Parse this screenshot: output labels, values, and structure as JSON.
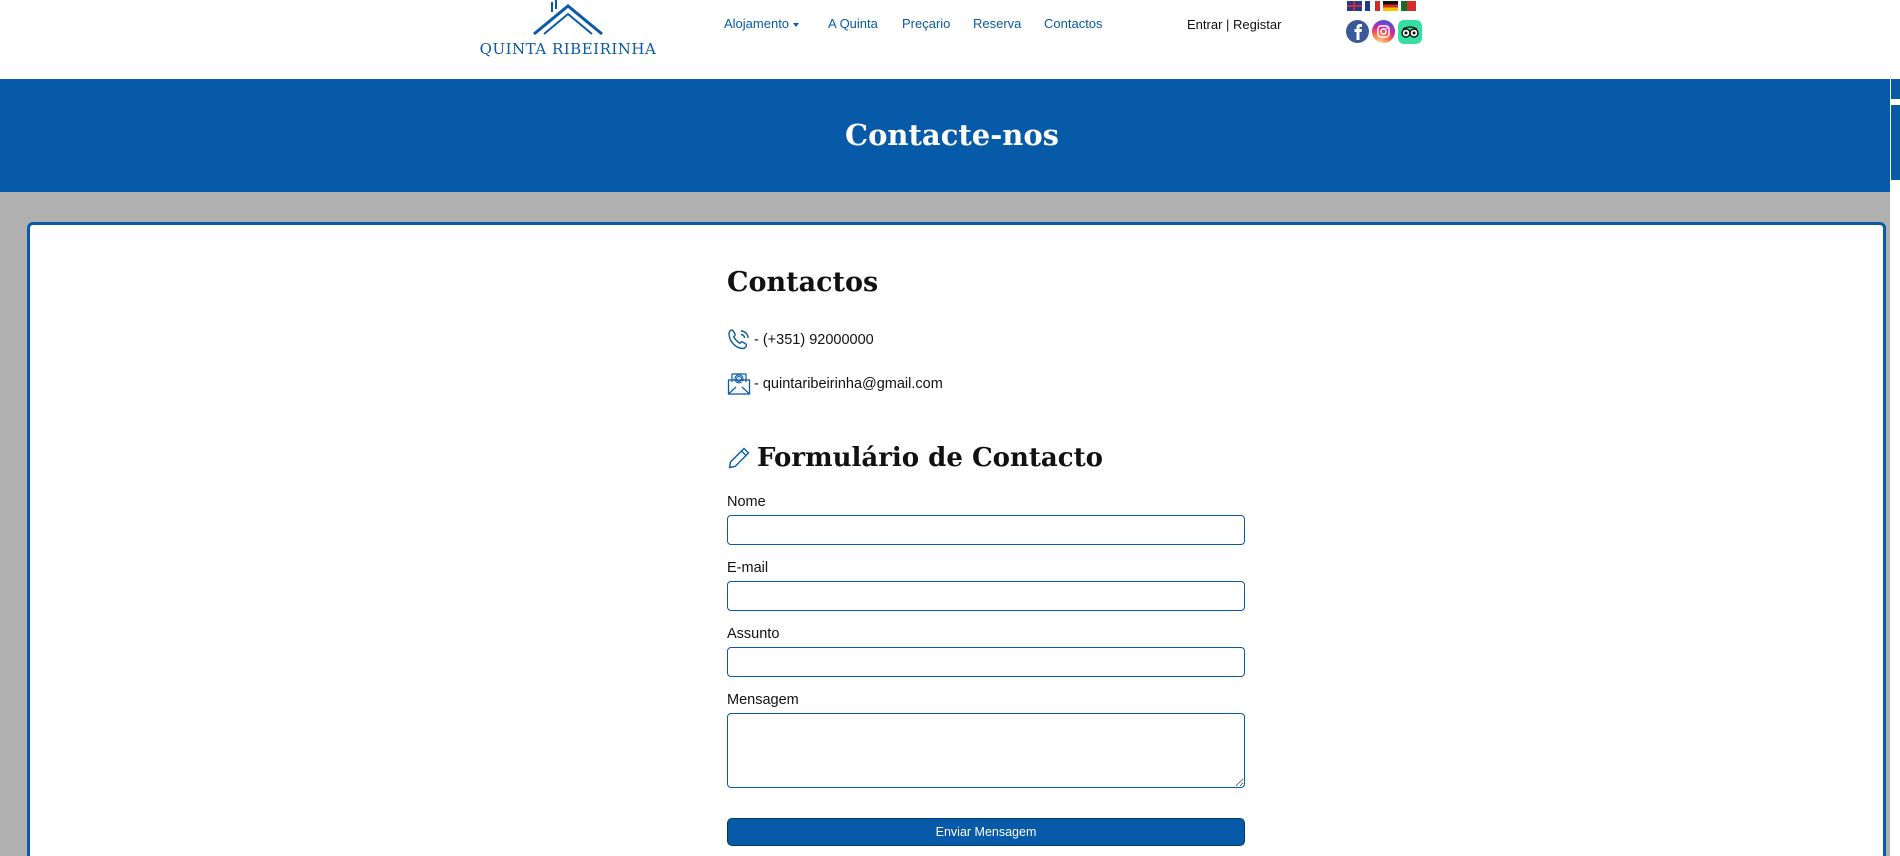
{
  "header": {
    "logo_text": "QUINTA RIBEIRINHA",
    "nav": [
      {
        "label": "Alojamento",
        "has_dropdown": true
      },
      {
        "label": "A Quinta"
      },
      {
        "label": "Preçario"
      },
      {
        "label": "Reserva"
      },
      {
        "label": "Contactos"
      }
    ],
    "auth": {
      "login": "Entrar",
      "separator": " | ",
      "register": "Registar"
    },
    "flags": [
      "uk-flag",
      "france-flag",
      "germany-flag",
      "portugal-flag"
    ],
    "social": [
      "facebook-icon",
      "instagram-icon",
      "tripadvisor-icon"
    ]
  },
  "banner": {
    "title": "Contacte-nos"
  },
  "contacts": {
    "title": "Contactos",
    "phone": "- (+351) 92000000",
    "email": "- quintaribeirinha@gmail.com"
  },
  "form": {
    "title": "Formulário de Contacto",
    "fields": {
      "name_label": "Nome",
      "email_label": "E-mail",
      "subject_label": "Assunto",
      "message_label": "Mensagem",
      "name_value": "",
      "email_value": "",
      "subject_value": "",
      "message_value": ""
    },
    "submit_label": "Enviar Mensagem"
  },
  "colors": {
    "brand_blue": "#065aa8",
    "grey_background": "#b0b0b0",
    "white": "#ffffff"
  }
}
